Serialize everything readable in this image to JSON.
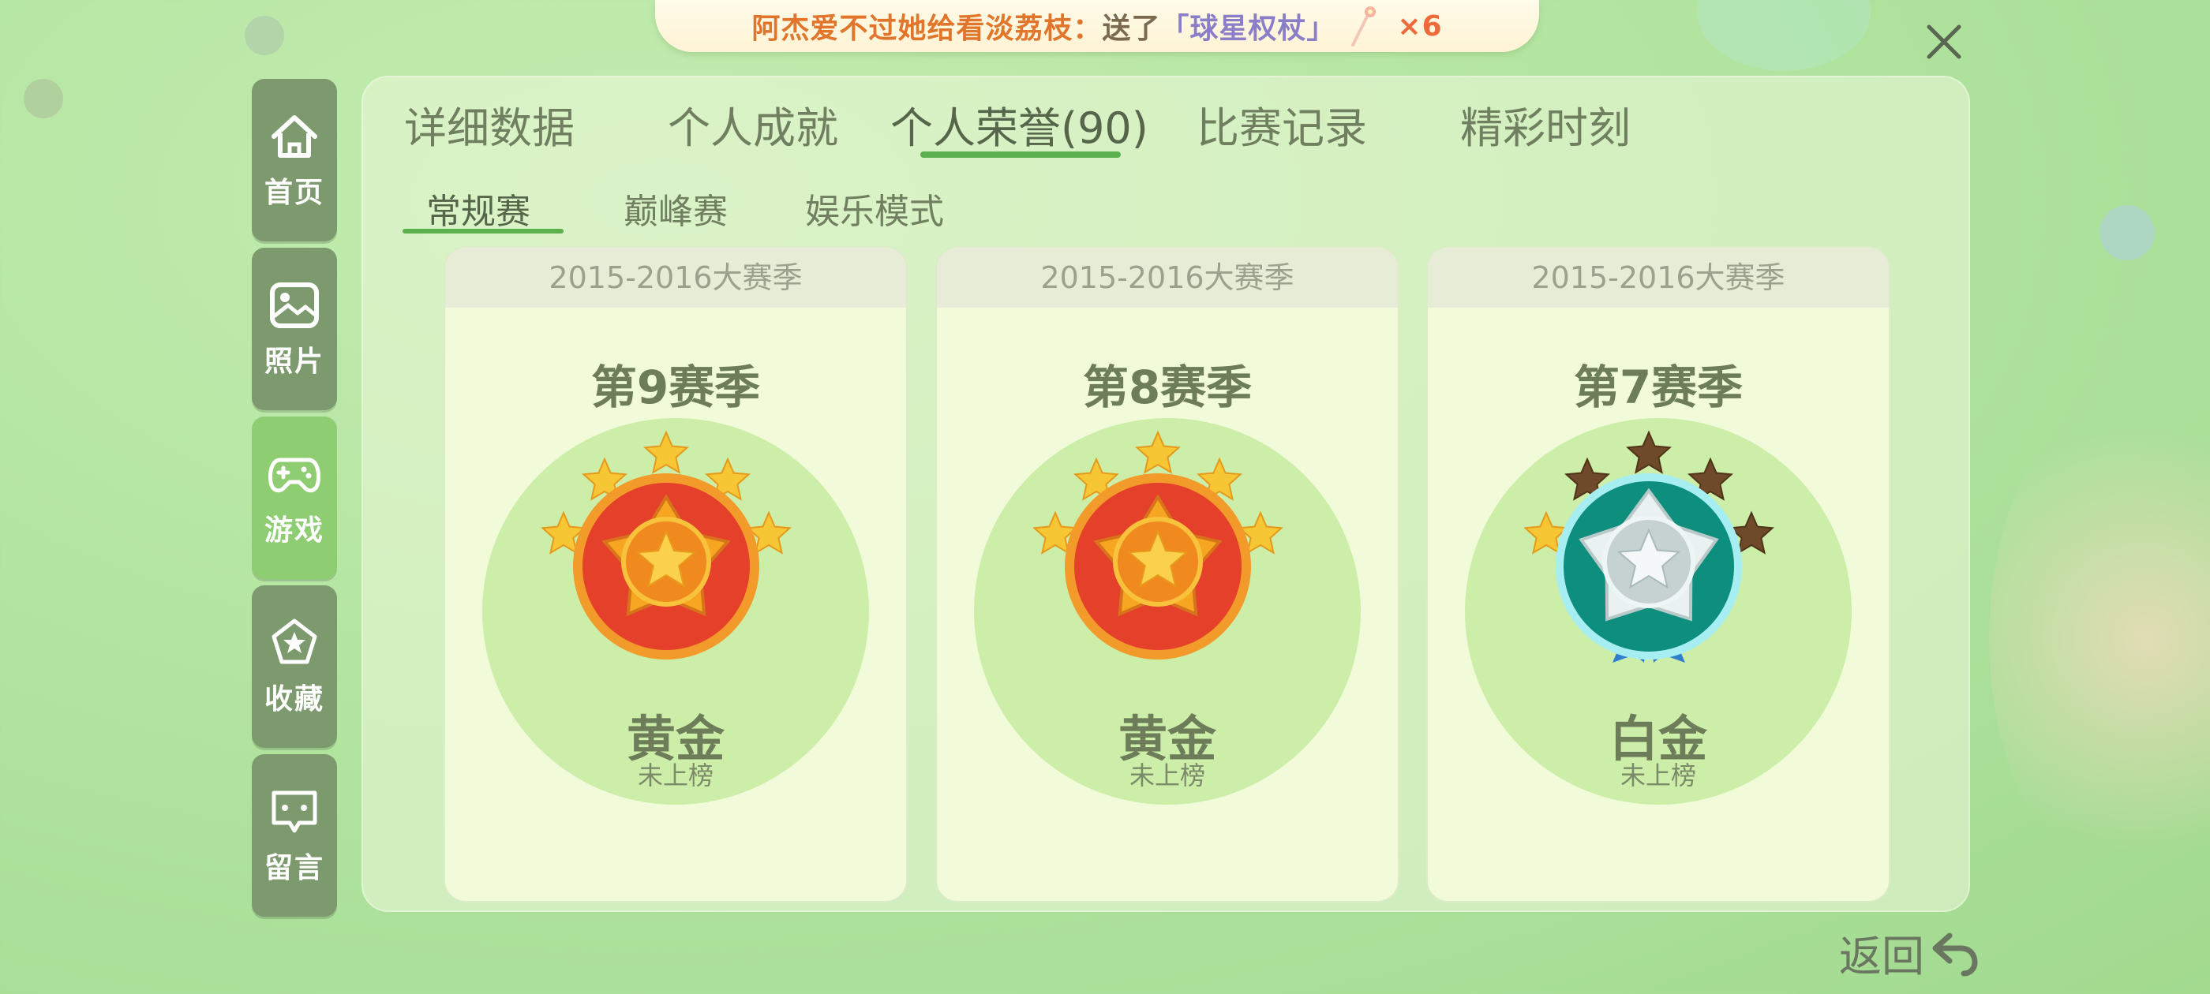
{
  "banner": {
    "sender_text": "阿杰爱不过她给看淡荔枝：",
    "sent_text": "送了",
    "gift_name": "「球星权杖」",
    "count_text": "×6",
    "gift_icon": "scepter-icon"
  },
  "close_icon": "close-icon",
  "sidebar": {
    "items": [
      {
        "label": "首页",
        "icon": "home-icon",
        "active": false
      },
      {
        "label": "照片",
        "icon": "image-icon",
        "active": false
      },
      {
        "label": "游戏",
        "icon": "gamepad-icon",
        "active": true
      },
      {
        "label": "收藏",
        "icon": "star-badge-icon",
        "active": false
      },
      {
        "label": "留言",
        "icon": "message-icon",
        "active": false
      }
    ]
  },
  "tabs": [
    {
      "label": "详细数据",
      "active": false
    },
    {
      "label": "个人成就",
      "active": false
    },
    {
      "label": "个人荣誉(90)",
      "active": true
    },
    {
      "label": "比赛记录",
      "active": false
    },
    {
      "label": "精彩时刻",
      "active": false
    }
  ],
  "subtabs": [
    {
      "label": "常规赛",
      "active": true
    },
    {
      "label": "巅峰赛",
      "active": false
    },
    {
      "label": "娱乐模式",
      "active": false
    }
  ],
  "cards": [
    {
      "season_range": "2015-2016大赛季",
      "season": "第9赛季",
      "rank": "黄金",
      "status": "未上榜",
      "stars_earned": 5,
      "stars_total": 5,
      "medal": "gold-medal"
    },
    {
      "season_range": "2015-2016大赛季",
      "season": "第8赛季",
      "rank": "黄金",
      "status": "未上榜",
      "stars_earned": 5,
      "stars_total": 5,
      "medal": "gold-medal"
    },
    {
      "season_range": "2015-2016大赛季",
      "season": "第7赛季",
      "rank": "白金",
      "status": "未上榜",
      "stars_earned": 1,
      "stars_total": 5,
      "medal": "platinum-medal"
    }
  ],
  "back": {
    "label": "返回",
    "icon": "back-arrow-icon"
  },
  "colors": {
    "accent_green": "#5cb04e",
    "sidebar_bg": "#7d9a6e",
    "sidebar_active_bg": "#8fcd72",
    "star_gold": "#f6c634",
    "star_dim": "#6e4a2a"
  }
}
